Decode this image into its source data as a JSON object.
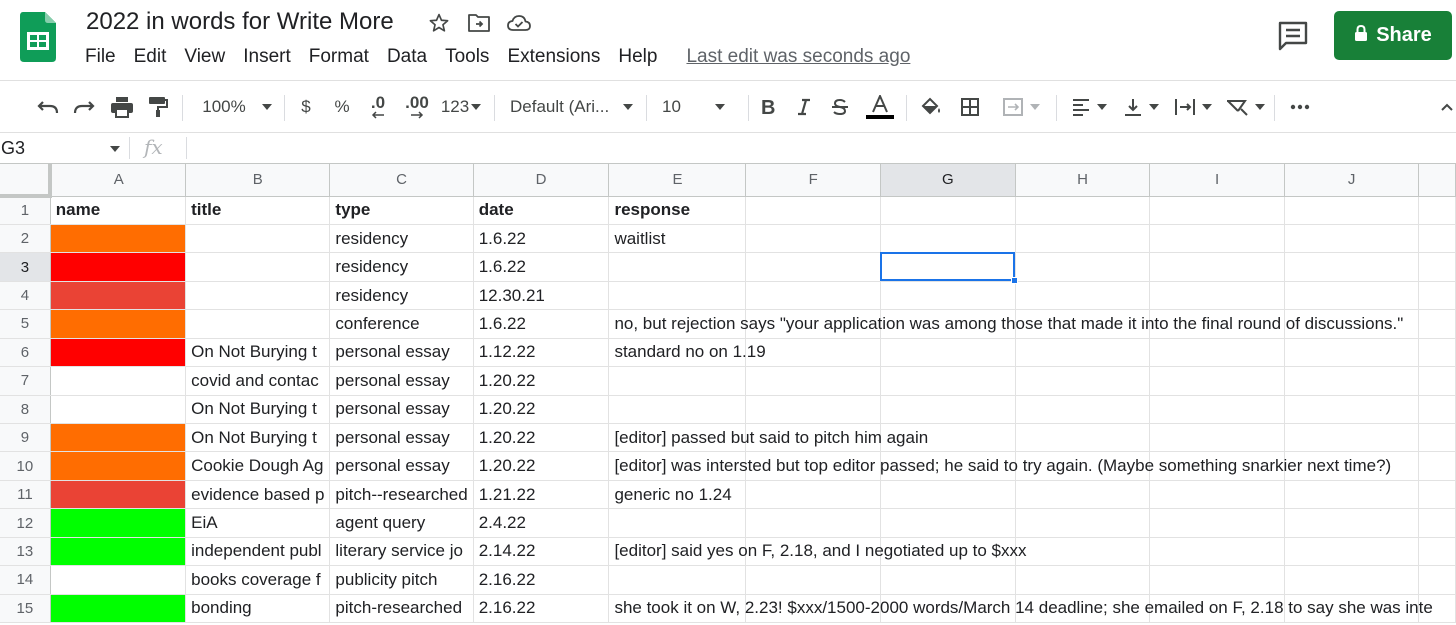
{
  "app": {
    "doc_title": "2022 in words for Write More",
    "menu": [
      "File",
      "Edit",
      "View",
      "Insert",
      "Format",
      "Data",
      "Tools",
      "Extensions",
      "Help"
    ],
    "last_edit": "Last edit was seconds ago",
    "share_label": "Share"
  },
  "toolbar": {
    "zoom": "100%",
    "currency": "$",
    "percent": "%",
    "decrease_decimal": ".0",
    "increase_decimal": ".00",
    "number_format": "123",
    "font_family": "Default (Ari...",
    "font_size": "10"
  },
  "formula_bar": {
    "cell_ref": "G3",
    "fx": "fx",
    "content": ""
  },
  "colors": {
    "orange": "#ff6d01",
    "red": "#ff0000",
    "light_red": "#ea4335",
    "green": "#00ff00",
    "brand_green": "#188038",
    "selection_blue": "#1a73e8"
  },
  "sheet": {
    "columns": [
      "A",
      "B",
      "C",
      "D",
      "E",
      "F",
      "G",
      "H",
      "I",
      "J"
    ],
    "selected_cell": "G3",
    "rows": [
      {
        "num": "1",
        "fill": "",
        "cells": [
          "name",
          "title",
          "type",
          "date",
          "response"
        ]
      },
      {
        "num": "2",
        "fill": "orange",
        "cells": [
          "",
          "",
          "residency",
          "1.6.22",
          "waitlist"
        ]
      },
      {
        "num": "3",
        "fill": "red",
        "cells": [
          "",
          "",
          "residency",
          "1.6.22",
          ""
        ]
      },
      {
        "num": "4",
        "fill": "light_red",
        "cells": [
          "",
          "",
          "residency",
          "12.30.21",
          ""
        ]
      },
      {
        "num": "5",
        "fill": "orange",
        "cells": [
          "",
          "",
          "conference",
          "1.6.22",
          "no, but rejection says \"your application was among those that made it into the final round of discussions.\""
        ]
      },
      {
        "num": "6",
        "fill": "red",
        "cells": [
          "",
          "On Not Burying t",
          "personal essay",
          "1.12.22",
          "standard no on 1.19"
        ]
      },
      {
        "num": "7",
        "fill": "",
        "cells": [
          "",
          "covid and contac",
          "personal essay",
          "1.20.22",
          ""
        ]
      },
      {
        "num": "8",
        "fill": "",
        "cells": [
          "",
          "On Not Burying t",
          "personal essay",
          "1.20.22",
          ""
        ]
      },
      {
        "num": "9",
        "fill": "orange",
        "cells": [
          "",
          "On Not Burying t",
          "personal essay",
          "1.20.22",
          "[editor] passed but said to pitch him again"
        ]
      },
      {
        "num": "10",
        "fill": "orange",
        "cells": [
          "",
          "Cookie Dough Ag",
          "personal essay",
          "1.20.22",
          "[editor] was intersted but top editor passed; he said to try again. (Maybe something snarkier next time?)"
        ]
      },
      {
        "num": "11",
        "fill": "light_red",
        "cells": [
          "",
          "evidence based p",
          "pitch--researched",
          "1.21.22",
          "generic no 1.24"
        ]
      },
      {
        "num": "12",
        "fill": "green",
        "cells": [
          "",
          "EiA",
          "agent query",
          "2.4.22",
          ""
        ]
      },
      {
        "num": "13",
        "fill": "green",
        "cells": [
          "",
          "independent publ",
          "literary service jo",
          "2.14.22",
          "[editor] said yes on F, 2.18, and I negotiated up to $xxx"
        ]
      },
      {
        "num": "14",
        "fill": "",
        "cells": [
          "",
          "books coverage f",
          "publicity pitch",
          "2.16.22",
          ""
        ]
      },
      {
        "num": "15",
        "fill": "green",
        "cells": [
          "",
          "bonding",
          "pitch-researched",
          "2.16.22",
          "she took it on W, 2.23! $xxx/1500-2000 words/March 14 deadline; she emailed on F, 2.18 to say she was inte"
        ]
      }
    ]
  }
}
